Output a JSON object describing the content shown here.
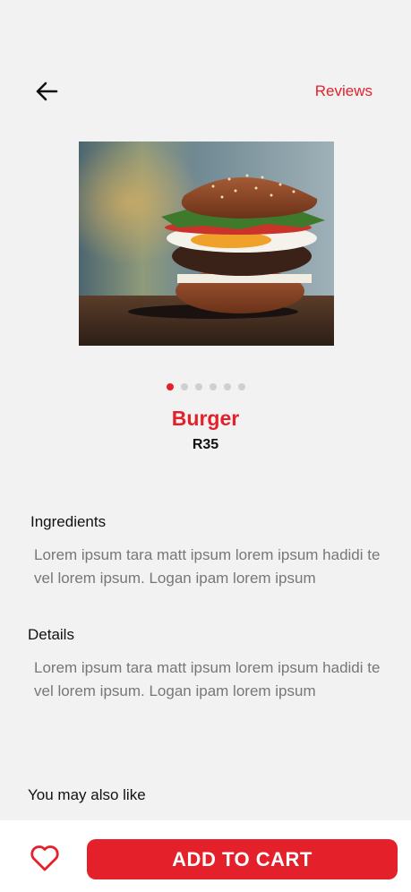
{
  "header": {
    "back_icon": "arrow-left-icon",
    "reviews_label": "Reviews"
  },
  "carousel": {
    "total": 6,
    "active_index": 0
  },
  "product": {
    "name": "Burger",
    "price": "R35"
  },
  "ingredients": {
    "title": "Ingredients",
    "text": "Lorem ipsum tara matt ipsum lorem ipsum hadidi te vel lorem ipsum. Logan ipam lorem ipsum"
  },
  "details": {
    "title": "Details",
    "text": "Lorem ipsum tara matt ipsum lorem ipsum hadidi te vel lorem ipsum. Logan ipam lorem ipsum"
  },
  "recommendations": {
    "title": "You may also like"
  },
  "footer": {
    "favorite_icon": "heart-icon",
    "add_to_cart_label": "ADD  TO CART"
  },
  "colors": {
    "accent": "#e4212b",
    "background": "#f2f2f2"
  }
}
